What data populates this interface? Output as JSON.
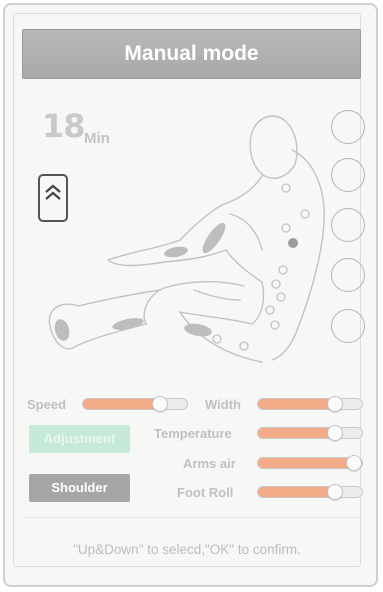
{
  "title": "Manual mode",
  "timer": {
    "value": "18",
    "unit": "Min"
  },
  "up_button": {
    "icon": "double-chevron-up-icon"
  },
  "controls": {
    "speed": {
      "label": "Speed",
      "level": 0.78
    },
    "width": {
      "label": "Width",
      "level": 0.78
    },
    "temperature": {
      "label": "Temperature",
      "level": 0.78
    },
    "arms_air": {
      "label": "Arms air",
      "level": 1.0
    },
    "foot_roll": {
      "label": "Foot Roll",
      "level": 0.78
    }
  },
  "buttons": {
    "adjustment": "Adjustment",
    "shoulder": "Shoulder"
  },
  "hint": "\"Up&Down\" to selecd,\"OK\" to confirm.",
  "colors": {
    "slider_fill": "#f2ab86",
    "title_bg": "#a8a8a8",
    "adjustment_bg": "#c6e9d8",
    "shoulder_bg": "#a6a6a6"
  }
}
